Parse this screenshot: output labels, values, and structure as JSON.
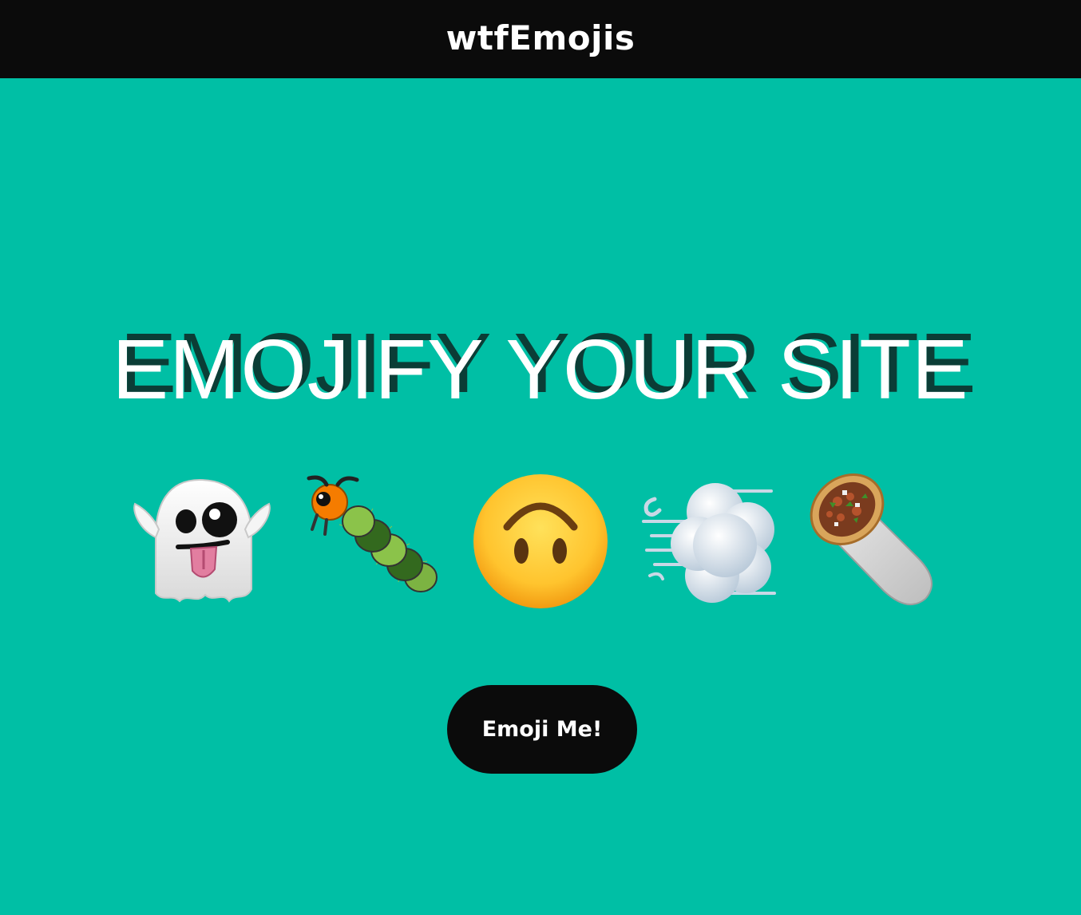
{
  "header": {
    "brand": "wtfEmojis"
  },
  "hero": {
    "headline": "EMOJIFY YOUR SITE",
    "emojis": [
      {
        "icon": "ghost-tongue-emoji"
      },
      {
        "icon": "caterpillar-emoji"
      },
      {
        "icon": "upside-down-face-emoji"
      },
      {
        "icon": "dash-smoke-emoji"
      },
      {
        "icon": "burrito-emoji"
      }
    ],
    "cta_label": "Emoji Me!"
  },
  "colors": {
    "background": "#00bfa5",
    "topbar": "#0b0b0b",
    "button": "#0b0b0b",
    "text": "#ffffff",
    "headline_shadow": "#0b3d36"
  }
}
